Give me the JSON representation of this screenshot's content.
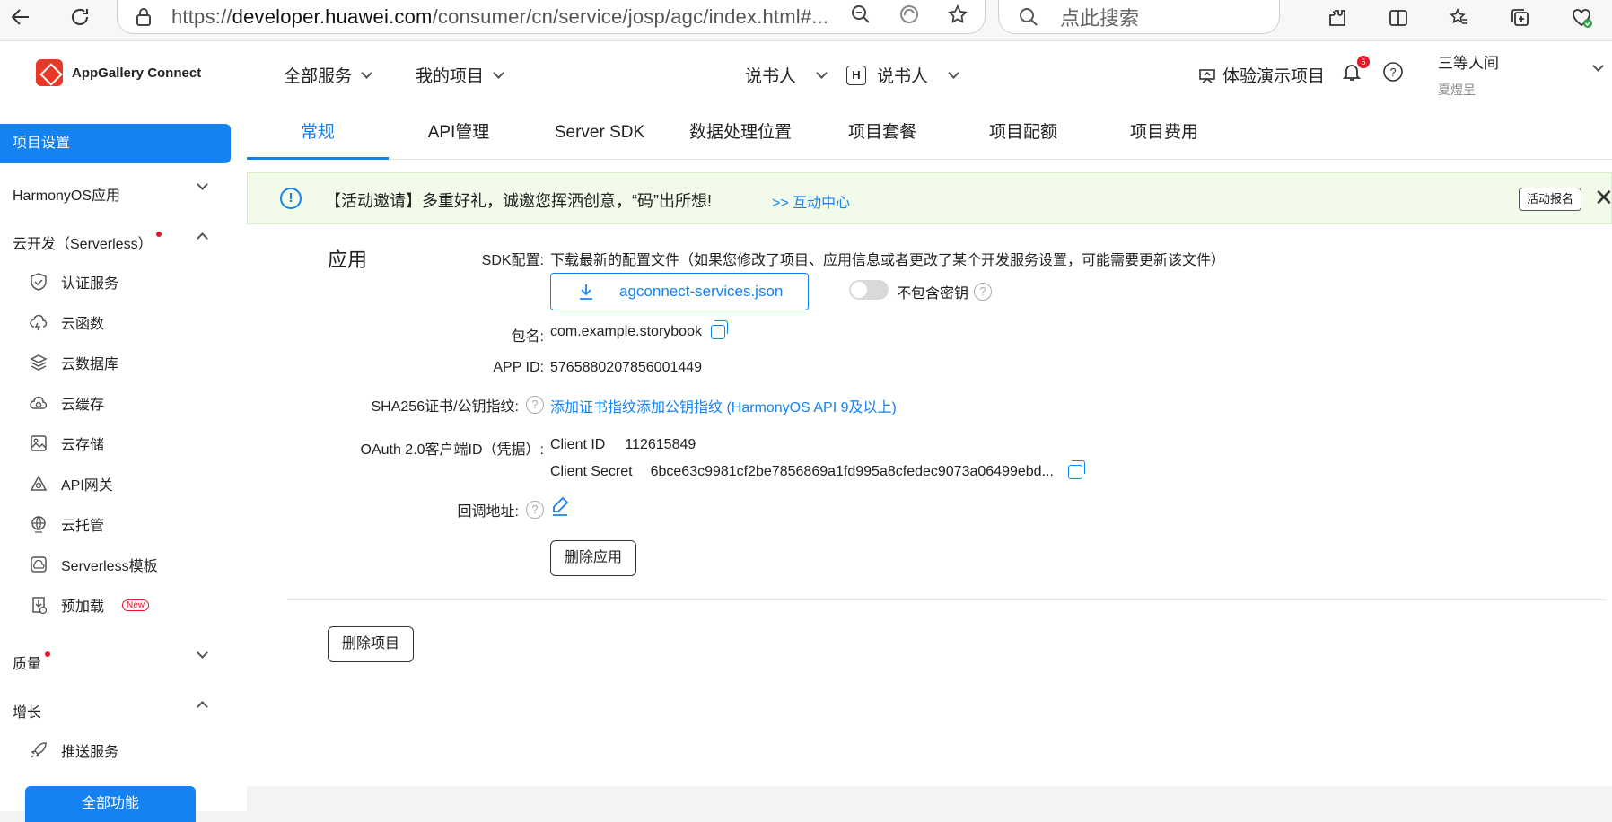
{
  "browser": {
    "url_prefix": "https://",
    "url_domain": "developer.huawei.com",
    "url_rest": "/consumer/cn/service/josp/agc/index.html#...",
    "search_placeholder": "点此搜索"
  },
  "header": {
    "logo": "AppGallery Connect",
    "all_services": "全部服务",
    "my_projects": "我的项目",
    "project": "说书人",
    "app_badge": "H",
    "app": "说书人",
    "demo": "体验演示项目",
    "bell_count": "5",
    "user_name": "三等人间",
    "user_sub": "夏煜呈"
  },
  "sidebar": {
    "active": "项目设置",
    "harmony": "HarmonyOS应用",
    "cloud": "云开发（Serverless）",
    "items": [
      "认证服务",
      "云函数",
      "云数据库",
      "云缓存",
      "云存储",
      "API网关",
      "云托管",
      "Serverless模板",
      "预加载"
    ],
    "new_tag": "New",
    "quality": "质量",
    "growth": "增长",
    "push": "推送服务",
    "all_func": "全部功能"
  },
  "tabs": [
    "常规",
    "API管理",
    "Server SDK",
    "数据处理位置",
    "项目套餐",
    "项目配额",
    "项目费用"
  ],
  "notice": {
    "msg": "【活动邀请】多重好礼，诚邀您挥洒创意，“码”出所想!",
    "link": ">> 互动中心",
    "apply": "活动报名",
    "close": "✕"
  },
  "app_section": {
    "title": "应用",
    "sdk_label": "SDK配置:",
    "sdk_desc": "下载最新的配置文件（如果您修改了项目、应用信息或者更改了某个开发服务设置，可能需要更新该文件）",
    "download_file": "agconnect-services.json",
    "no_key": "不包含密钥",
    "pkg_label": "包名:",
    "pkg_value": "com.example.storybook",
    "appid_label": "APP ID:",
    "appid_value": "5765880207856001449",
    "sha_label": "SHA256证书/公钥指纹:",
    "sha_link1": "添加证书指纹",
    "sha_link2": "添加公钥指纹 (HarmonyOS API 9及以上)",
    "oauth_label": "OAuth 2.0客户端ID（凭据）:",
    "client_id_label": "Client ID",
    "client_id_value": "112615849",
    "client_secret_label": "Client Secret",
    "client_secret_value": "6bce63c9981cf2be7856869a1fd995a8cfedec9073a06499ebd...",
    "callback_label": "回调地址:",
    "delete_app": "删除应用",
    "delete_project": "删除项目"
  }
}
